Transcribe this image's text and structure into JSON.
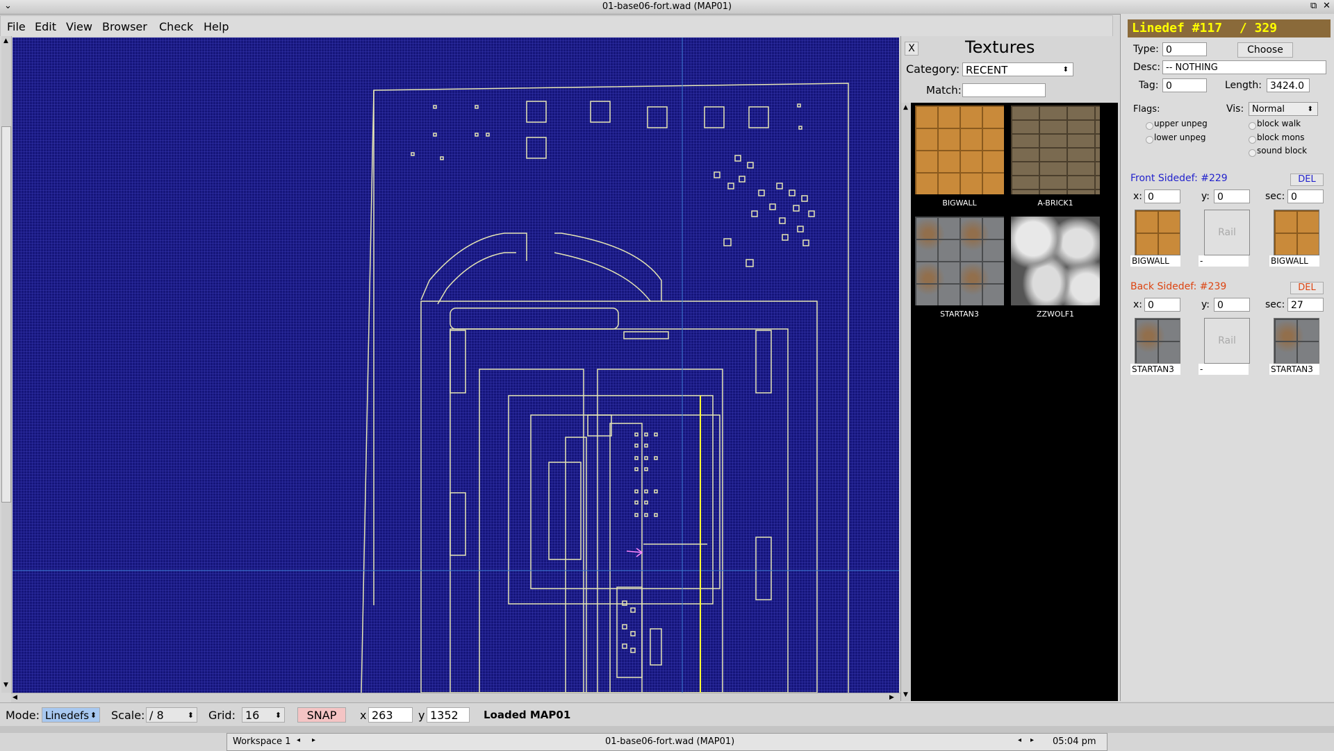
{
  "window": {
    "title": "01-base06-fort.wad (MAP01)"
  },
  "menu": {
    "items": [
      "File",
      "Edit",
      "View",
      "Browser",
      "Check",
      "Help"
    ]
  },
  "textures": {
    "close_label": "X",
    "title": "Textures",
    "category_label": "Category:",
    "category_value": "RECENT",
    "match_label": "Match:",
    "match_value": "",
    "items": [
      {
        "name": "BIGWALL",
        "icon": "bigwall-texture"
      },
      {
        "name": "A-BRICK1",
        "icon": "abrick1-texture"
      },
      {
        "name": "STARTAN3",
        "icon": "startan3-texture"
      },
      {
        "name": "ZZWOLF1",
        "icon": "zzwolf1-texture"
      }
    ]
  },
  "linedef": {
    "header": "Linedef #117",
    "total": "/ 329",
    "type_label": "Type:",
    "type_value": "0",
    "choose_label": "Choose",
    "desc_label": "Desc:",
    "desc_value": "-- NOTHING",
    "tag_label": "Tag:",
    "tag_value": "0",
    "length_label": "Length:",
    "length_value": "3424.0",
    "flags_label": "Flags:",
    "vis_label": "Vis:",
    "vis_value": "Normal",
    "flags_left": [
      "upper unpeg",
      "lower unpeg"
    ],
    "flags_right": [
      "block walk",
      "block mons",
      "sound block"
    ]
  },
  "front": {
    "label": "Front Sidedef: #229",
    "del_label": "DEL",
    "x_label": "x:",
    "x_value": "0",
    "y_label": "y:",
    "y_value": "0",
    "sec_label": "sec:",
    "sec_value": "0",
    "upper": "BIGWALL",
    "rail": "Rail",
    "middle": "-",
    "lower": "BIGWALL",
    "color": "#2222cc"
  },
  "back": {
    "label": "Back Sidedef: #239",
    "del_label": "DEL",
    "x_label": "x:",
    "x_value": "0",
    "y_label": "y:",
    "y_value": "0",
    "sec_label": "sec:",
    "sec_value": "27",
    "upper": "STARTAN3",
    "rail": "Rail",
    "middle": "-",
    "lower": "STARTAN3",
    "color": "#dd4411"
  },
  "status": {
    "mode_label": "Mode:",
    "mode_value": "Linedefs",
    "scale_label": "Scale:",
    "scale_value": "/ 8",
    "grid_label": "Grid:",
    "grid_value": "16",
    "snap_label": "SNAP",
    "x_label": "x",
    "x_value": "263",
    "y_label": "y",
    "y_value": "1352",
    "message": "Loaded MAP01"
  },
  "taskbar": {
    "workspace": "Workspace 1",
    "window_title": "01-base06-fort.wad (MAP01)",
    "clock": "05:04 pm"
  },
  "colors": {
    "map_bg": "#15157a",
    "map_lines": "#e0e0b0",
    "selected_line": "#ffff33",
    "header_text": "#ffff00",
    "header_bg": "#8a6a3a"
  }
}
